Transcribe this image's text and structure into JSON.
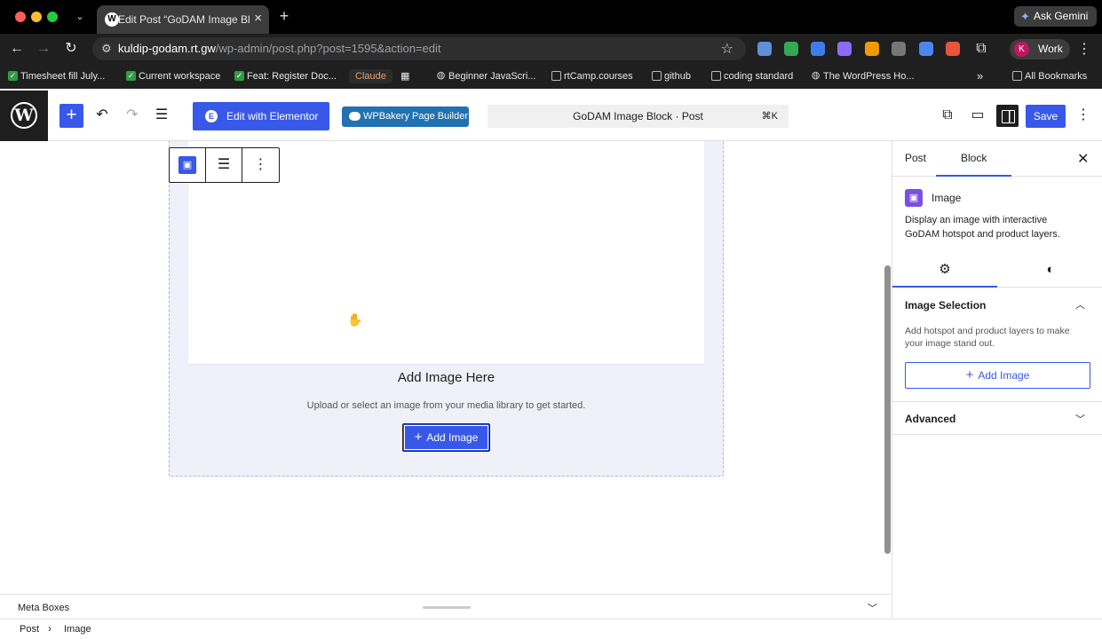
{
  "browser": {
    "tab_title": "Edit Post “GoDAM Image Block",
    "tab_favicon": "W",
    "ask_gemini": "Ask Gemini",
    "url_host": "kuldip-godam.rt.gw",
    "url_path": "/wp-admin/post.php?post=1595&action=edit",
    "profile_initial": "K",
    "profile_name": "Work",
    "bookmarks": [
      "Timesheet fill July...",
      "Current workspace",
      "Feat: Register Doc...",
      "Claude",
      "Beginner JavaScri...",
      "rtCamp.courses",
      "github",
      "coding standard",
      "The WordPress Ho..."
    ],
    "all_bookmarks": "All Bookmarks",
    "overflow": "»",
    "extension_colors": [
      "#5f8fd8",
      "#34a853",
      "#3f7ee8",
      "#8a6cff",
      "#f29900",
      "#777777",
      "#4d86f0",
      "#e8553a"
    ]
  },
  "editor": {
    "wp_logo": "W",
    "elementor_label": "Edit with Elementor",
    "wpbakery_label": "WPBakery Page Builder",
    "command_title": "GoDAM Image Block · Post",
    "command_shortcut": "⌘K",
    "save_label": "Save",
    "accent_color": "#3858e9"
  },
  "block": {
    "title": "Add Image Here",
    "description": "Upload or select an image from your media library to get started.",
    "add_label": "Add Image",
    "plus": "+"
  },
  "sidebar": {
    "tab_post": "Post",
    "tab_block": "Block",
    "block_name": "Image",
    "block_description": "Display an image with interactive GoDAM hotspot and product layers.",
    "panel_title": "Image Selection",
    "panel_help": "Add hotspot and product layers to make your image stand out.",
    "panel_add_label": "Add Image",
    "advanced_title": "Advanced"
  },
  "footer": {
    "meta_boxes": "Meta Boxes",
    "crumb_post": "Post",
    "crumb_image": "Image"
  }
}
